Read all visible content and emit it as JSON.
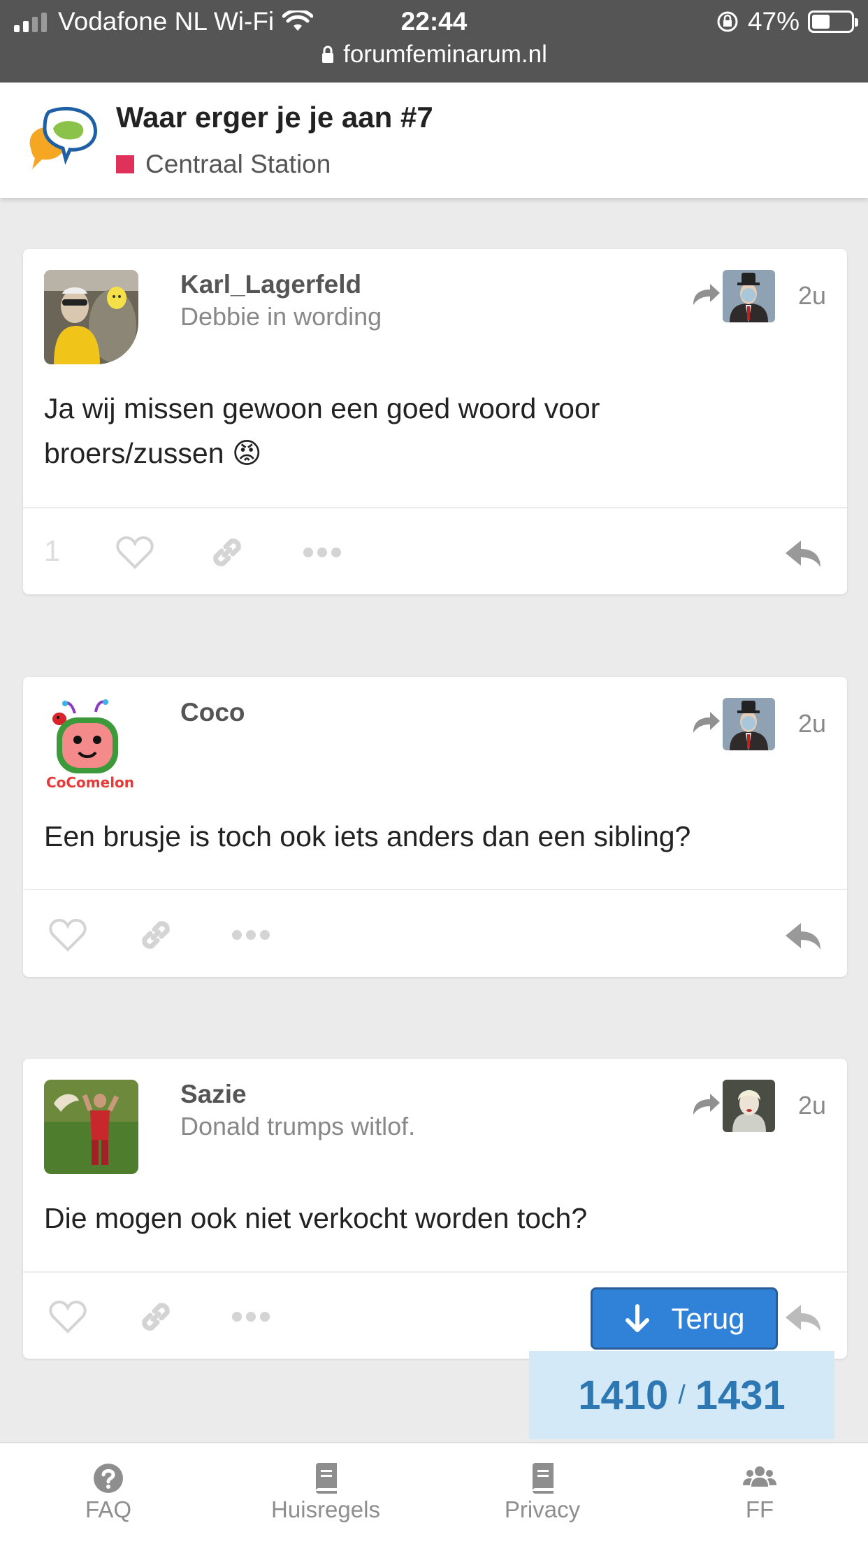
{
  "status_bar": {
    "carrier": "Vodafone NL Wi-Fi",
    "time": "22:44",
    "battery": "47%",
    "battery_level": 0.47,
    "url": "forumfeminarum.nl"
  },
  "topic": {
    "title": "Waar erger je je aan #7",
    "category": "Centraal Station",
    "category_color": "#e0315b"
  },
  "posts": [
    {
      "username": "Karl_Lagerfeld",
      "user_title": "Debbie in wording",
      "date": "2u",
      "body": "Ja wij missen gewoon een goed woord voor broers/zussen",
      "emoji": "😡",
      "like_count": "1"
    },
    {
      "username": "Coco",
      "user_title": "",
      "date": "2u",
      "body": "Een brusje is toch ook iets anders dan een sibling?",
      "avatar_text": "CoComelon"
    },
    {
      "username": "Sazie",
      "user_title": "Donald trumps witlof.",
      "date": "2u",
      "body": "Die mogen ook niet verkocht worden toch?"
    }
  ],
  "back_button": {
    "label": "Terug"
  },
  "progress": {
    "current": "1410",
    "separator": "/",
    "total": "1431"
  },
  "footer": {
    "items": [
      {
        "label": "FAQ",
        "icon": "question-circle-icon"
      },
      {
        "label": "Huisregels",
        "icon": "book-icon"
      },
      {
        "label": "Privacy",
        "icon": "book-icon"
      },
      {
        "label": "FF",
        "icon": "users-icon"
      }
    ]
  },
  "colors": {
    "accent_blue": "#2f82d8",
    "progress_bg": "#d4e9f8",
    "progress_text": "#2d78b2"
  }
}
